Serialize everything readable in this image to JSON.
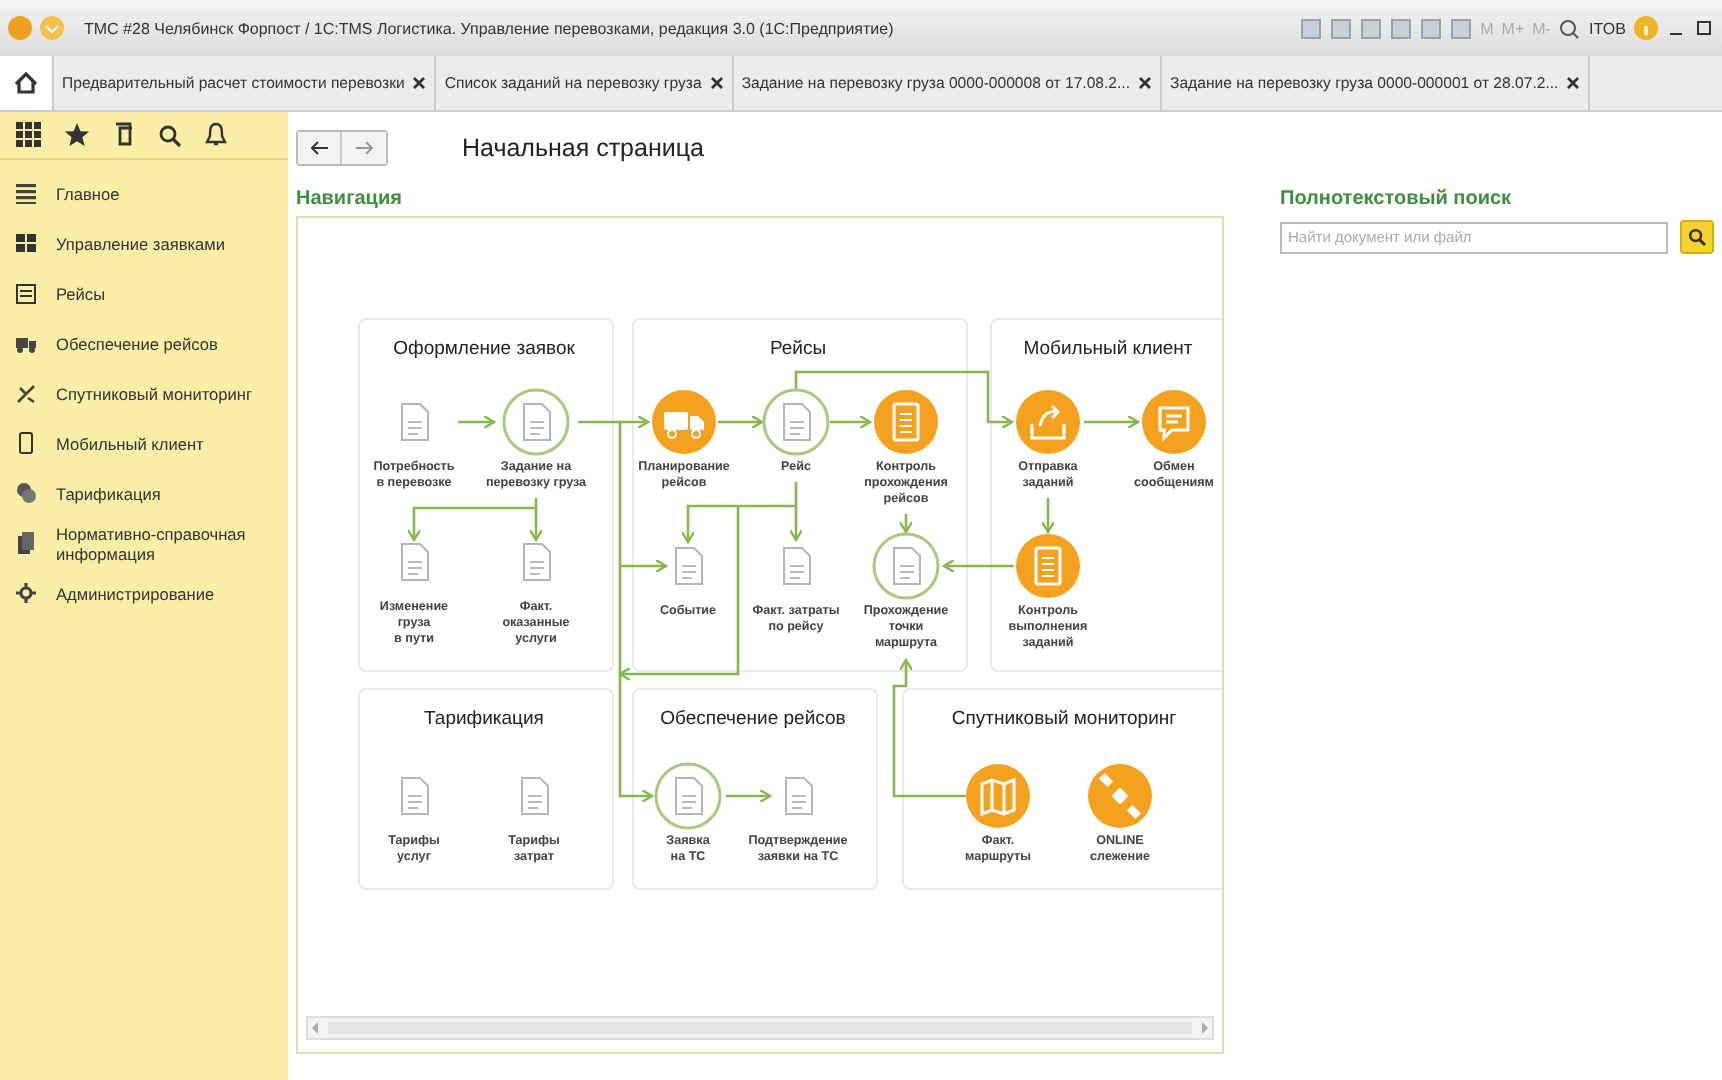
{
  "window": {
    "title": "ТМС #28 Челябинск Форпост / 1С:TMS Логистика. Управление перевозками, редакция 3.0 (1С:Предприятие)",
    "memory_buttons": [
      "M",
      "M+",
      "M-"
    ],
    "user": "ITOB"
  },
  "tabs": [
    {
      "kind": "home",
      "selected": true
    },
    {
      "label": "Предварительный расчет стоимости перевозки",
      "selected": false
    },
    {
      "label": "Список заданий на перевозку груза",
      "selected": false
    },
    {
      "label": "Задание на перевозку груза 0000-000008 от 17.08.2...",
      "selected": false
    },
    {
      "label": "Задание на перевозку груза 0000-000001 от 28.07.2...",
      "selected": false
    }
  ],
  "sidebar": {
    "items": [
      {
        "label": "Главное"
      },
      {
        "label": "Управление заявками"
      },
      {
        "label": "Рейсы"
      },
      {
        "label": "Обеспечение рейсов"
      },
      {
        "label": "Спутниковый мониторинг"
      },
      {
        "label": "Мобильный клиент"
      },
      {
        "label": "Тарификация"
      },
      {
        "label": "Нормативно-справочная информация"
      },
      {
        "label": "Администрирование"
      }
    ]
  },
  "page_title": "Начальная страница",
  "navigation": {
    "title": "Навигация",
    "groups": [
      {
        "title": "Оформление заявок",
        "nodes": [
          {
            "label": "Потребность\nв перевозке",
            "kind": "doc"
          },
          {
            "label": "Задание на\nперевозку груза",
            "kind": "doc-circle"
          },
          {
            "label": "Изменение\nгруза\nв пути",
            "kind": "doc"
          },
          {
            "label": "Факт.\nоказанные\nуслуги",
            "kind": "doc"
          }
        ]
      },
      {
        "title": "Рейсы",
        "nodes": [
          {
            "label": "Планирование\nрейсов",
            "kind": "truck"
          },
          {
            "label": "Рейс",
            "kind": "doc-circle"
          },
          {
            "label": "Контроль\nпрохождения\nрейсов",
            "kind": "clipboard"
          },
          {
            "label": "Событие",
            "kind": "doc"
          },
          {
            "label": "Факт. затраты\nпо рейсу",
            "kind": "doc"
          },
          {
            "label": "Прохождение\nточки\nмаршрута",
            "kind": "doc-circle"
          }
        ]
      },
      {
        "title": "Мобильный клиент",
        "nodes": [
          {
            "label": "Отправка\nзаданий",
            "kind": "send"
          },
          {
            "label": "Обмен\nсообщениям",
            "kind": "chat"
          },
          {
            "label": "Контроль\nвыполнения\nзаданий",
            "kind": "clipboard"
          }
        ]
      },
      {
        "title": "Тарификация",
        "nodes": [
          {
            "label": "Тарифы\nуслуг",
            "kind": "doc"
          },
          {
            "label": "Тарифы\nзатрат",
            "kind": "doc"
          }
        ]
      },
      {
        "title": "Обеспечение рейсов",
        "nodes": [
          {
            "label": "Заявка\nна ТС",
            "kind": "doc-circle"
          },
          {
            "label": "Подтверждение\nзаявки на ТС",
            "kind": "doc"
          }
        ]
      },
      {
        "title": "Спутниковый мониторинг",
        "nodes": [
          {
            "label": "Факт.\nмаршруты",
            "kind": "map"
          },
          {
            "label": "ONLINE\nслежение",
            "kind": "satellite"
          }
        ]
      }
    ]
  },
  "search": {
    "title": "Полнотекстовый поиск",
    "placeholder": "Найти документ или файл"
  }
}
